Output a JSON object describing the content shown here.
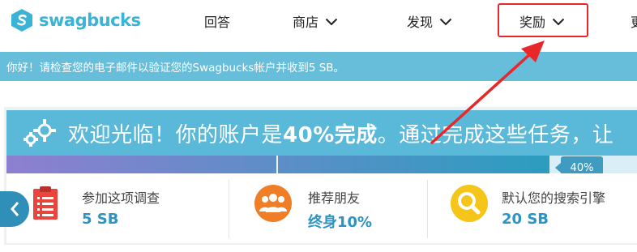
{
  "logo": {
    "text": "swagbucks"
  },
  "nav": {
    "items": [
      {
        "label": "回答",
        "has_dropdown": false
      },
      {
        "label": "商店",
        "has_dropdown": true
      },
      {
        "label": "发现",
        "has_dropdown": true
      },
      {
        "label": "奖励",
        "has_dropdown": true
      },
      {
        "label": "更",
        "has_dropdown": false
      }
    ]
  },
  "notice": {
    "text": "你好！请检查您的电子邮件以验证您的Swagbucks帐户并收到5 SB。"
  },
  "welcome": {
    "text_before": "欢迎光临！你的账户是",
    "percent_bold": "40%完成",
    "text_after": "。通过完成这些任务，让"
  },
  "progress": {
    "value": 0.4,
    "badge": "40%"
  },
  "tasks": [
    {
      "title": "参加这项调查",
      "reward": "5 SB",
      "icon": "survey-clipboard-icon",
      "icon_color": "#e8453c"
    },
    {
      "title": "推荐朋友",
      "reward": "终身10%",
      "icon": "people-group-icon",
      "icon_color": "#f07e26"
    },
    {
      "title": "默认您的搜索引擎",
      "reward": "20 SB",
      "icon": "magnifier-icon",
      "icon_color": "#f5c51a"
    }
  ],
  "colors": {
    "brand": "#3bb3d6",
    "notice_bg": "#67bedb",
    "welcome_bg": "#5ab8d9",
    "progress_start": "#8e7fd0",
    "progress_end": "#2b9dbf",
    "reward_text": "#2d93c1",
    "highlight": "#e8272b"
  }
}
